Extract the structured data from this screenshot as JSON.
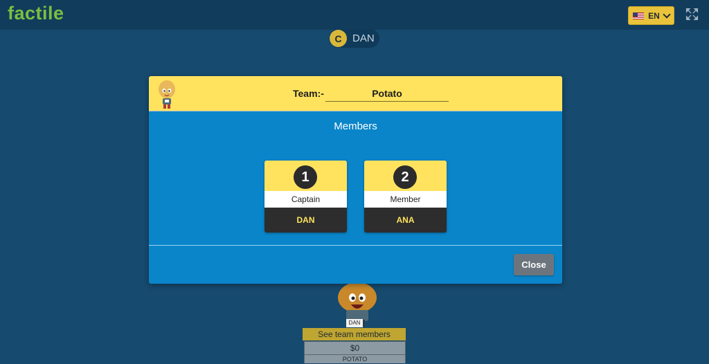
{
  "app": {
    "logo": "factile"
  },
  "header": {
    "language_label": "EN",
    "language_flag": "us-flag-icon"
  },
  "player": {
    "initial": "C",
    "name": "DAN"
  },
  "modal": {
    "team_label": "Team:-",
    "team_name": "Potato",
    "members_title": "Members",
    "members": [
      {
        "number": "1",
        "role": "Captain",
        "name": "DAN"
      },
      {
        "number": "2",
        "role": "Member",
        "name": "ANA"
      }
    ],
    "close_label": "Close"
  },
  "background_team": {
    "avatar_tag": "DAN",
    "see_members_label": "See team members",
    "score": "$0",
    "team_name": "POTATO"
  },
  "colors": {
    "background": "#164a6e",
    "topbar": "#123c5c",
    "modal_blue": "#0a85c9",
    "accent_yellow": "#ffe35e",
    "logo_green": "#7bbf3f"
  }
}
